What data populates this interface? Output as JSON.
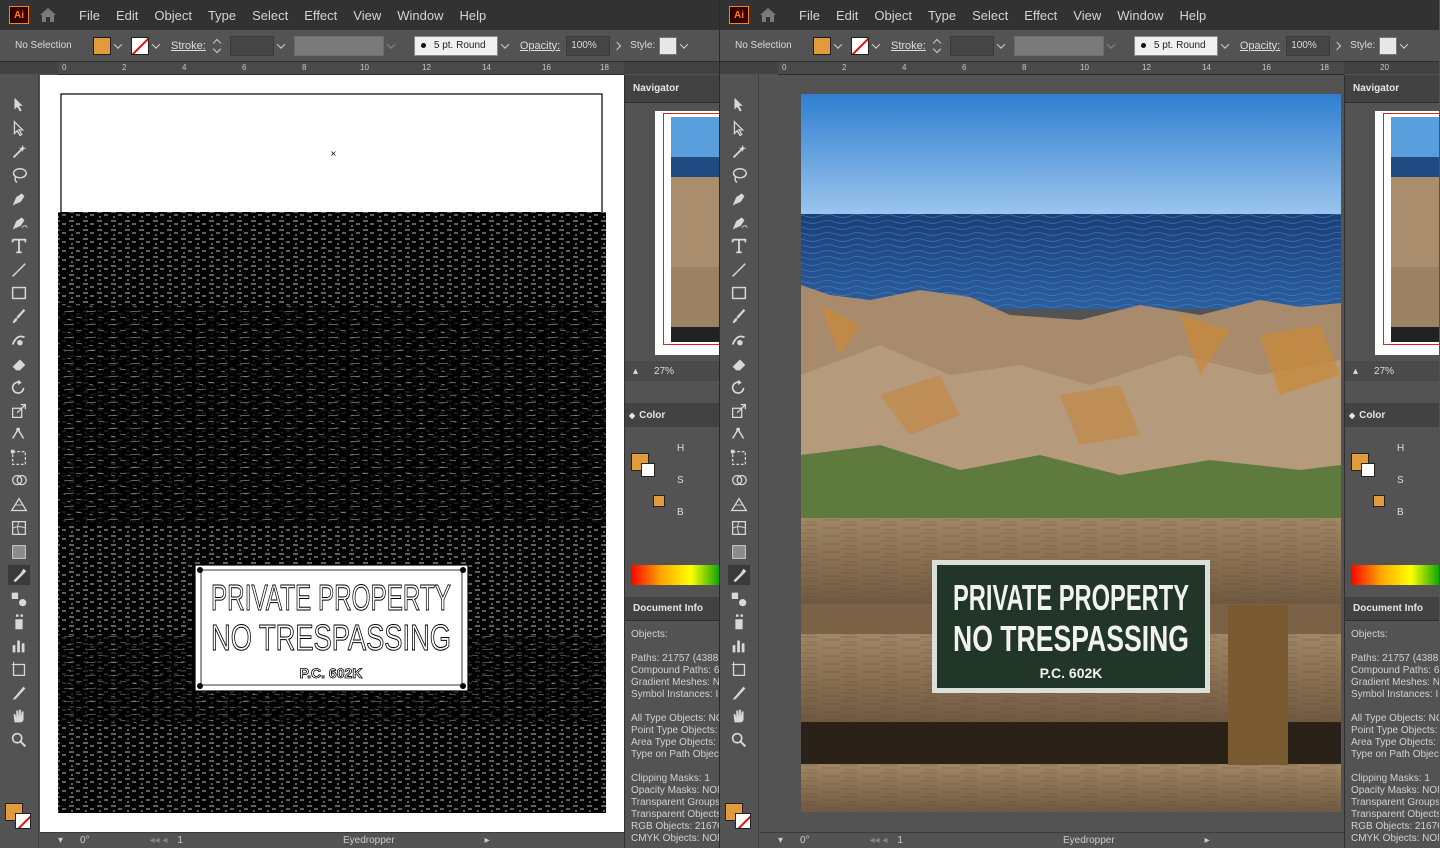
{
  "app": {
    "logo": "Ai",
    "menu": [
      "File",
      "Edit",
      "Object",
      "Type",
      "Select",
      "Effect",
      "View",
      "Window",
      "Help"
    ]
  },
  "control": {
    "selection": "No Selection",
    "stroke_label": "Stroke:",
    "brush": "5 pt. Round",
    "opacity_label": "Opacity:",
    "opacity_value": "100%",
    "style_label": "Style:",
    "fill_color": "#e39a3b"
  },
  "ruler": {
    "ticks": [
      "0",
      "2",
      "4",
      "6",
      "8",
      "10",
      "12",
      "14",
      "16",
      "18",
      "20"
    ]
  },
  "tools": [
    "selection-tool-icon",
    "direct-selection-tool-icon",
    "magic-wand-icon",
    "lasso-icon",
    "pen-icon",
    "curvature-icon",
    "type-icon",
    "line-icon",
    "rectangle-icon",
    "paintbrush-icon",
    "shaper-icon",
    "eraser-icon",
    "rotate-icon",
    "scale-icon",
    "puppet-warp-icon",
    "free-transform-icon",
    "shape-builder-icon",
    "perspective-icon",
    "mesh-icon",
    "gradient-icon",
    "eyedropper-icon",
    "blend-icon",
    "symbol-sprayer-icon",
    "graph-icon",
    "artboard-icon",
    "slice-icon",
    "hand-icon",
    "zoom-icon"
  ],
  "panels": {
    "navigator": "Navigator",
    "zoom": "27%",
    "color": "Color",
    "color_h": "H",
    "color_s": "S",
    "color_b": "B",
    "document_info": "Document Info",
    "doc_lines": [
      "Objects:",
      "",
      "Paths: 21757 (4388",
      "Compound Paths: 6",
      "Gradient Meshes: N",
      "Symbol Instances: I",
      "",
      "All Type Objects: NO",
      "Point Type Objects:",
      "Area Type Objects:",
      "Type on Path Object",
      "",
      "Clipping Masks: 1",
      "Opacity Masks: NONE",
      "Transparent Groups",
      "Transparent Objects",
      "RGB Objects: 21676",
      "CMYK Objects: NON"
    ]
  },
  "status": {
    "rotation": "0°",
    "artboard": "1",
    "tool": "Eyedropper"
  },
  "sign": {
    "line1": "PRIVATE PROPERTY",
    "line2": "NO TRESPASSING",
    "line3": "P.C. 602K"
  }
}
